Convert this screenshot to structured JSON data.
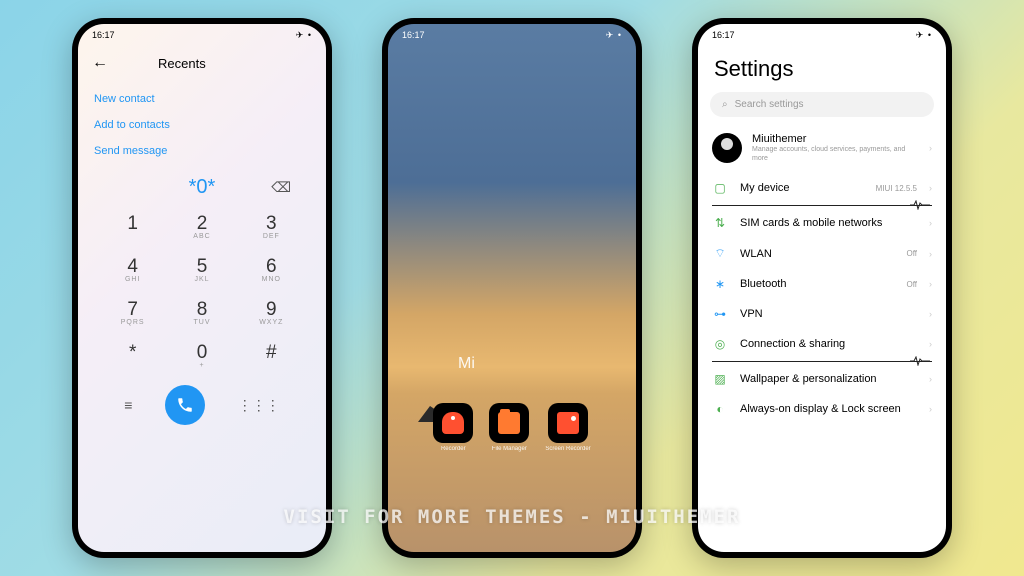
{
  "status": {
    "time": "16:17",
    "icons": "✈ •"
  },
  "phone1": {
    "title": "Recents",
    "actions": [
      "New contact",
      "Add to contacts",
      "Send message"
    ],
    "typed": "*0*",
    "keys": [
      {
        "num": "1",
        "let": ""
      },
      {
        "num": "2",
        "let": "ABC"
      },
      {
        "num": "3",
        "let": "DEF"
      },
      {
        "num": "4",
        "let": "GHI"
      },
      {
        "num": "5",
        "let": "JKL"
      },
      {
        "num": "6",
        "let": "MNO"
      },
      {
        "num": "7",
        "let": "PQRS"
      },
      {
        "num": "8",
        "let": "TUV"
      },
      {
        "num": "9",
        "let": "WXYZ"
      },
      {
        "num": "*",
        "let": ""
      },
      {
        "num": "0",
        "let": "+"
      },
      {
        "num": "#",
        "let": ""
      }
    ]
  },
  "phone2": {
    "brand": "Mi",
    "apps": [
      {
        "label": "Recorder"
      },
      {
        "label": "File Manager"
      },
      {
        "label": "Screen Recorder"
      }
    ]
  },
  "phone3": {
    "title": "Settings",
    "search_placeholder": "Search settings",
    "account": {
      "name": "Miuithemer",
      "desc": "Manage accounts, cloud services, payments, and more"
    },
    "rows": [
      {
        "icon": "▢",
        "color": "#4caf50",
        "label": "My device",
        "value": "MIUI 12.5.5"
      },
      {
        "icon": "⇅",
        "color": "#4caf50",
        "label": "SIM cards & mobile networks",
        "value": ""
      },
      {
        "icon": "⌔",
        "color": "#2196f3",
        "label": "WLAN",
        "value": "Off"
      },
      {
        "icon": "∗",
        "color": "#2196f3",
        "label": "Bluetooth",
        "value": "Off"
      },
      {
        "icon": "⊶",
        "color": "#2196f3",
        "label": "VPN",
        "value": ""
      },
      {
        "icon": "◎",
        "color": "#4caf50",
        "label": "Connection & sharing",
        "value": ""
      },
      {
        "icon": "▨",
        "color": "#4caf50",
        "label": "Wallpaper & personalization",
        "value": ""
      },
      {
        "icon": "◐",
        "color": "#4caf50",
        "label": "Always-on display & Lock screen",
        "value": ""
      }
    ]
  },
  "watermark": "VISIT FOR MORE THEMES - MIUITHEMER"
}
